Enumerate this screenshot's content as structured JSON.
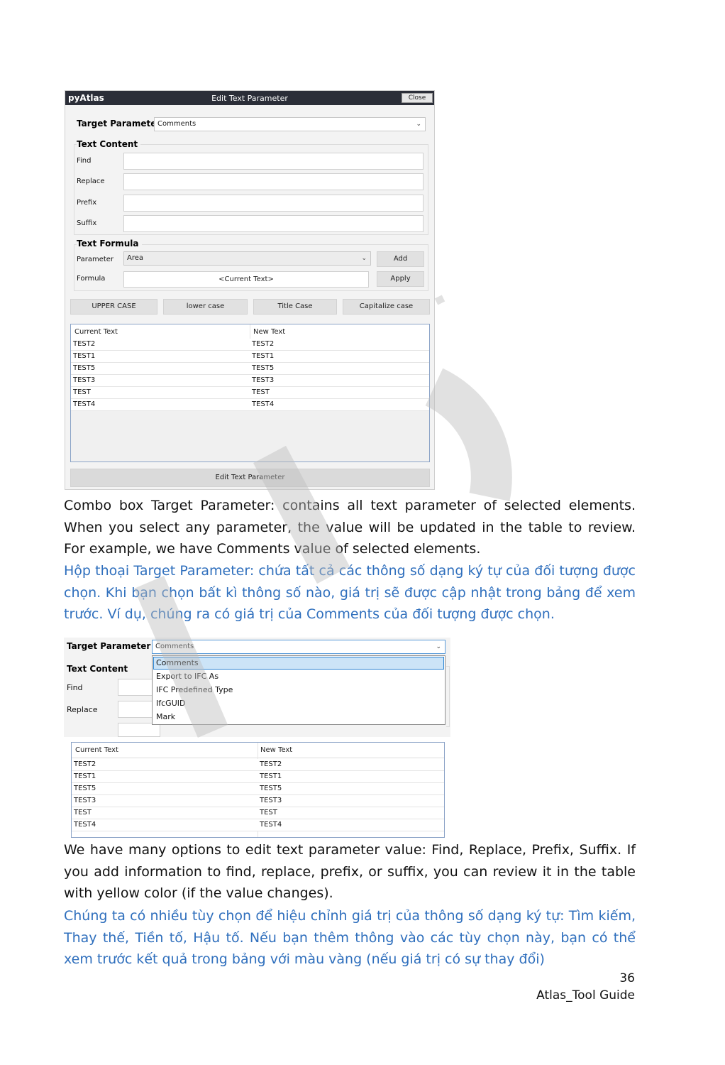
{
  "dialog": {
    "app_name": "pyAtlas",
    "title": "Edit Text Parameter",
    "close_label": "Close",
    "target_parameter_label": "Target Parameter",
    "target_parameter_value": "Comments",
    "text_content_label": "Text Content",
    "find_label": "Find",
    "replace_label": "Replace",
    "prefix_label": "Prefix",
    "suffix_label": "Suffix",
    "text_formula_label": "Text Formula",
    "parameter_label": "Parameter",
    "parameter_value": "Area",
    "add_label": "Add",
    "formula_label": "Formula",
    "formula_value": "<Current Text>",
    "apply_label": "Apply",
    "case_buttons": [
      "UPPER CASE",
      "lower case",
      "Title Case",
      "Capitalize case"
    ],
    "table": {
      "columns": [
        "Current Text",
        "New Text"
      ],
      "rows": [
        [
          "TEST2",
          "TEST2"
        ],
        [
          "TEST1",
          "TEST1"
        ],
        [
          "TEST5",
          "TEST5"
        ],
        [
          "TEST3",
          "TEST3"
        ],
        [
          "TEST",
          "TEST"
        ],
        [
          "TEST4",
          "TEST4"
        ]
      ]
    },
    "run_label": "Edit Text Parameter"
  },
  "para1_en": "Combo box Target Parameter: contains all text parameter of selected elements. When you select any parameter, the value will be updated in the table to review. For example, we have Comments value of selected elements.",
  "para1_vi": "Hộp thoại Target Parameter: chứa tất cả các thông số dạng ký tự của đối tượng được chọn. Khi bạn chọn bất kì thông số nào, giá trị sẽ được cập nhật trong bảng để xem trước. Ví dụ, chúng ra có giá trị của Comments của đối tượng được chọn.",
  "shot2": {
    "target_parameter_label": "Target Parameter",
    "target_parameter_value": "Comments",
    "text_content_label": "Text Content",
    "find_label": "Find",
    "replace_label": "Replace",
    "dropdown_options": [
      "Comments",
      "Export to IFC As",
      "IFC Predefined Type",
      "IfcGUID",
      "Mark"
    ],
    "table": {
      "columns": [
        "Current Text",
        "New Text"
      ],
      "rows": [
        [
          "TEST2",
          "TEST2"
        ],
        [
          "TEST1",
          "TEST1"
        ],
        [
          "TEST5",
          "TEST5"
        ],
        [
          "TEST3",
          "TEST3"
        ],
        [
          "TEST",
          "TEST"
        ],
        [
          "TEST4",
          "TEST4"
        ]
      ]
    }
  },
  "para2_en": "We have many options to edit text parameter value: Find, Replace, Prefix, Suffix. If you add information to find, replace, prefix, or suffix, you can review it in the table with yellow color (if the value changes).",
  "para2_vi": "Chúng ta có nhiều tùy chọn để hiệu chỉnh giá trị của thông số dạng ký tự: Tìm kiếm, Thay thế, Tiền tố, Hậu tố. Nếu bạn thêm thông vào các tùy chọn này, bạn có thể xem trước kết quả trong bảng với màu vàng (nếu giá trị có sự thay đổi)",
  "page_number": "36",
  "doc_title": "Atlas_Tool Guide",
  "colors": {
    "titlebar": "#2b2e38",
    "english_text": "#111111",
    "vietnamese_text": "#2f6fbd",
    "selection": "#cce4f7"
  }
}
